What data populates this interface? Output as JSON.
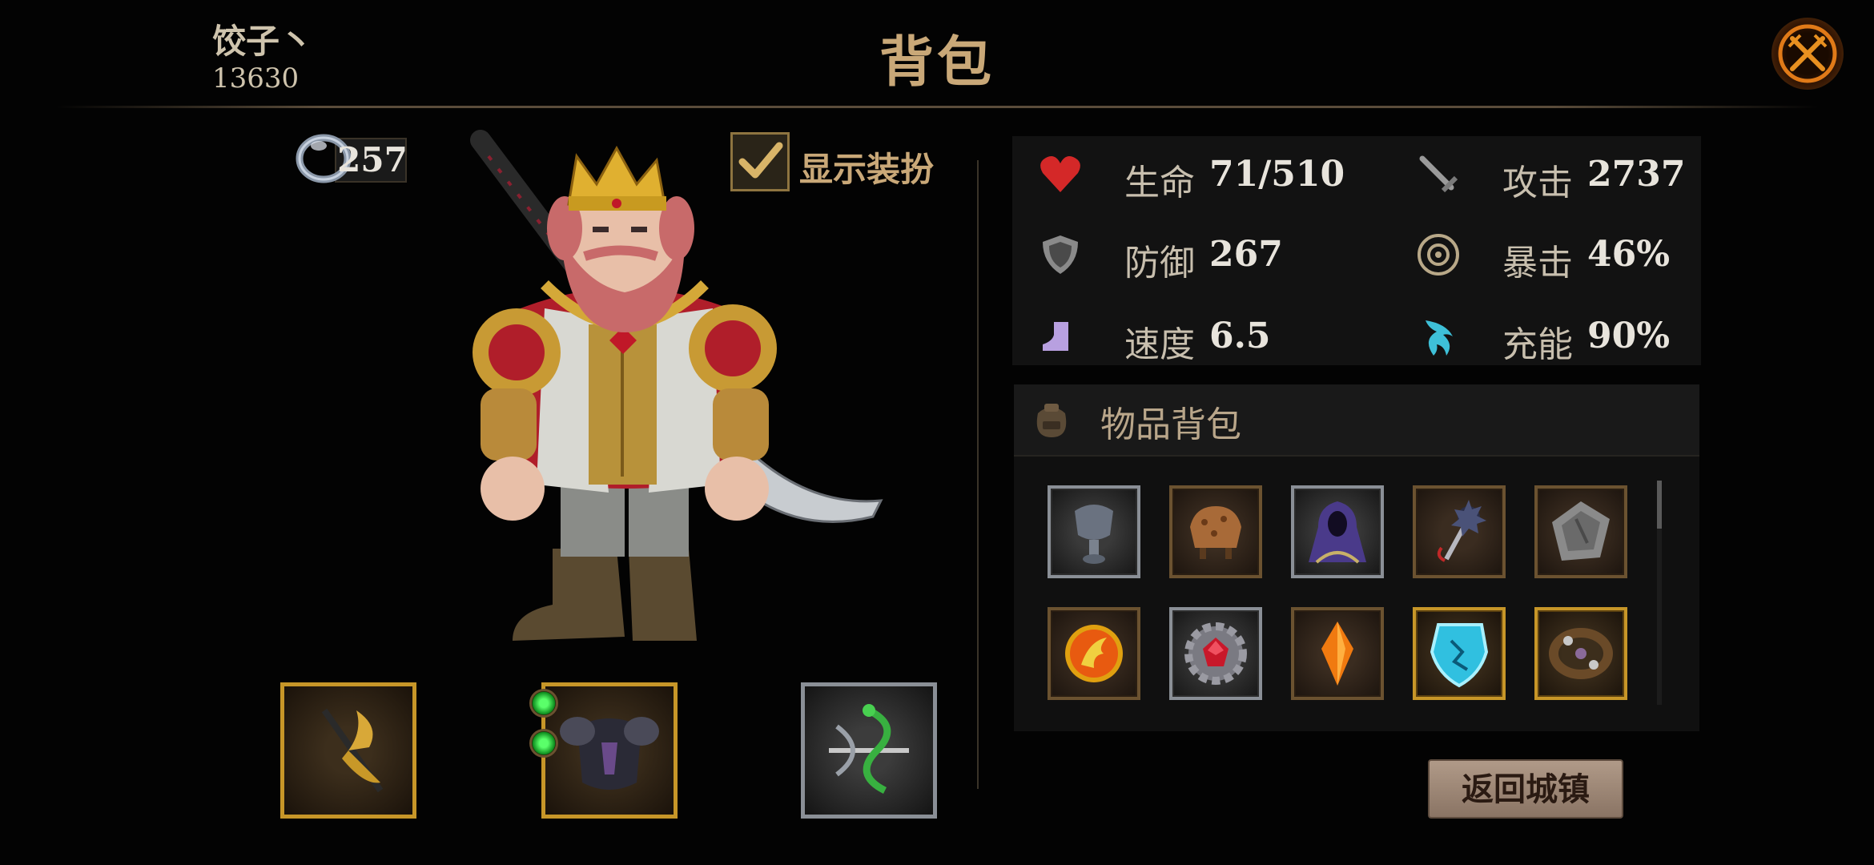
{
  "header": {
    "player_name": "饺子丶",
    "player_id": "13630",
    "title": "背包",
    "close_icon": "crossed-swords-close-icon"
  },
  "currency": {
    "icon": "ring-gem-icon",
    "value": "257"
  },
  "costume_toggle": {
    "label": "显示装扮",
    "checked": true
  },
  "stats": [
    {
      "name": "life",
      "icon": "heart-icon",
      "label": "生命",
      "value": "71/510",
      "color": "#d42828"
    },
    {
      "name": "attack",
      "icon": "sword-icon",
      "label": "攻击",
      "value": "2737",
      "color": "#9a9a9a"
    },
    {
      "name": "defense",
      "icon": "shield-icon",
      "label": "防御",
      "value": "267",
      "color": "#9a9a9a"
    },
    {
      "name": "crit",
      "icon": "crit-target-icon",
      "label": "暴击",
      "value": "46%",
      "color": "#b8a888"
    },
    {
      "name": "speed",
      "icon": "boot-icon",
      "label": "速度",
      "value": "6.5",
      "color": "#b8a0e0"
    },
    {
      "name": "charge",
      "icon": "energy-flame-icon",
      "label": "充能",
      "value": "90%",
      "color": "#3ec0d8"
    }
  ],
  "inventory": {
    "title": "物品背包",
    "icon": "bag-icon",
    "items": [
      {
        "name": "helmet",
        "icon": "helmet-icon",
        "rarity": "silver"
      },
      {
        "name": "leather-armor",
        "icon": "leather-armor-icon",
        "rarity": "bronze"
      },
      {
        "name": "hooded-robe",
        "icon": "hooded-robe-icon",
        "rarity": "silver"
      },
      {
        "name": "spiked-mace",
        "icon": "spiked-mace-icon",
        "rarity": "bronze"
      },
      {
        "name": "stone-shield",
        "icon": "stone-shield-icon",
        "rarity": "bronze"
      },
      {
        "name": "fire-coin",
        "icon": "fire-coin-icon",
        "rarity": "bronze"
      },
      {
        "name": "ruby-gear",
        "icon": "ruby-gear-icon",
        "rarity": "silver"
      },
      {
        "name": "amber-crystal",
        "icon": "amber-crystal-icon",
        "rarity": "bronze"
      },
      {
        "name": "ice-shield",
        "icon": "ice-shield-icon",
        "rarity": "gold"
      },
      {
        "name": "bracelet",
        "icon": "bracelet-icon",
        "rarity": "gold"
      }
    ]
  },
  "equipment": [
    {
      "name": "weapon-slot",
      "icon": "golden-blade-icon",
      "rarity": "gold"
    },
    {
      "name": "armor-slot",
      "icon": "dark-armor-icon",
      "rarity": "gold",
      "sockets": 2
    },
    {
      "name": "accessory-slot",
      "icon": "serpent-crossbow-icon",
      "rarity": "silver"
    }
  ],
  "return_button": {
    "label": "返回城镇"
  }
}
